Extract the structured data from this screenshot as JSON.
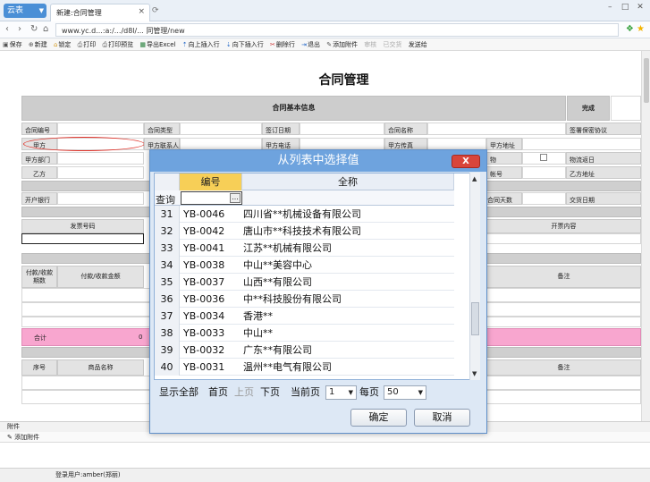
{
  "browser": {
    "logo_label": "云表",
    "tab_title": "新建:合同管理",
    "url": "www.yc.d...:a:/.../d8l/... 同管理/new"
  },
  "toolbar": {
    "items": [
      "保存",
      "新建",
      "锁定",
      "打印",
      "打印预览",
      "导出Excel",
      "向上插入行",
      "向下插入行",
      "删除行",
      "退出",
      "添加附件",
      "审核",
      "已交货",
      "发送给"
    ]
  },
  "form": {
    "title": "合同管理",
    "section_basic": "合同基本信息",
    "complete_label": "完成",
    "labels": {
      "contract_no": "合同编号",
      "contract_type": "合同类型",
      "sign_date": "签订日期",
      "contract_name": "合同名称",
      "supply_agreement": "签署保密协议",
      "party_a": "甲方",
      "party_a_contact": "甲方联系人",
      "party_a_phone": "甲方电话",
      "party_a_fax": "甲方传真",
      "party_a_address": "甲方地址",
      "party_a_dept": "甲方部门",
      "logistics": "物",
      "logistics_date": "物流返日",
      "party_b": "乙方",
      "account_no": "帐号",
      "party_b_address": "乙方地址",
      "bank": "开户银行",
      "contract_days": "合同天数",
      "delivery_date": "交货日期",
      "invoice_no": "发票号码",
      "ticket_content": "开票内容",
      "pay_period": "付款/收款期数",
      "pay_amount": "付款/收款金额",
      "remark": "备注",
      "total": "合计",
      "total_value": "0",
      "seq": "序号",
      "product_name": "商品名称",
      "remark2": "备注"
    }
  },
  "attachments": {
    "tab_label": "附件",
    "add_label": "添加附件"
  },
  "status": {
    "login_user": "登录用户:amber(郑丽)"
  },
  "dialog": {
    "title": "从列表中选择值",
    "close_label": "X",
    "col_code": "编号",
    "col_name": "全称",
    "filter_label": "查询",
    "filter_btn": "...",
    "rows": [
      {
        "n": "31",
        "code": "YB-0046",
        "name": "四川省**机械设备有限公司"
      },
      {
        "n": "32",
        "code": "YB-0042",
        "name": "唐山市**科技技术有限公司"
      },
      {
        "n": "33",
        "code": "YB-0041",
        "name": "江苏**机械有限公司"
      },
      {
        "n": "34",
        "code": "YB-0038",
        "name": "中山**美容中心"
      },
      {
        "n": "35",
        "code": "YB-0037",
        "name": "山西**有限公司"
      },
      {
        "n": "36",
        "code": "YB-0036",
        "name": "中**科技股份有限公司"
      },
      {
        "n": "37",
        "code": "YB-0034",
        "name": "香港**"
      },
      {
        "n": "38",
        "code": "YB-0033",
        "name": "中山**"
      },
      {
        "n": "39",
        "code": "YB-0032",
        "name": "广东**有限公司"
      },
      {
        "n": "40",
        "code": "YB-0031",
        "name": "温州**电气有限公司"
      }
    ],
    "pager": {
      "show_all": "显示全部",
      "first": "首页",
      "prev": "上页",
      "next": "下页",
      "current_label": "当前页",
      "current_value": "1",
      "per_page_label": "每页",
      "per_page_value": "50"
    },
    "ok_label": "确定",
    "cancel_label": "取消"
  }
}
